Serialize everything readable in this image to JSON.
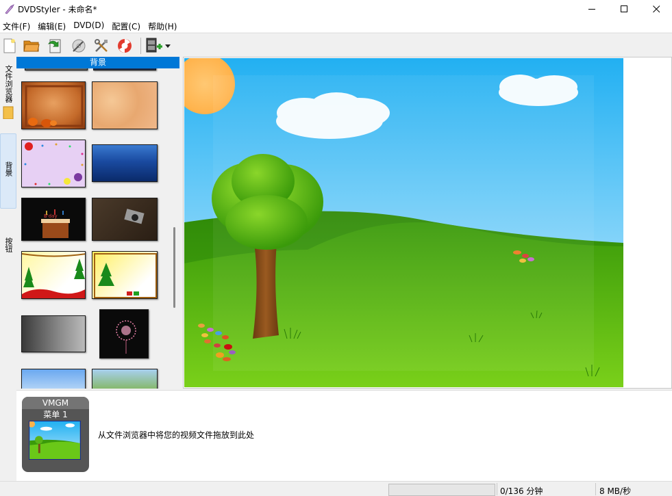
{
  "window": {
    "title": "DVDStyler - 未命名*"
  },
  "menubar": {
    "items": [
      "文件(F)",
      "编辑(E)",
      "DVD(D)",
      "配置(C)",
      "帮助(H)"
    ]
  },
  "toolbar": {
    "buttons": [
      "new-file-icon",
      "open-folder-icon",
      "save-icon",
      "burn-disc-icon",
      "settings-tools-icon",
      "help-lifebuoy-icon",
      "add-video-icon"
    ]
  },
  "side_tabs": {
    "file_browser": "文件浏览器",
    "backgrounds": "背景",
    "buttons": "按钮"
  },
  "background_panel": {
    "header": "背景"
  },
  "titleset": {
    "vmgm_label": "VMGM",
    "menu_label": "菜单 1",
    "drop_hint": "从文件浏览器中将您的视频文件拖放到此处"
  },
  "statusbar": {
    "time": "0/136 分钟",
    "rate": "8 MB/秒"
  },
  "colors": {
    "accent": "#0078d7",
    "sky_top": "#2ab4f2",
    "grass": "#4fb40f"
  }
}
